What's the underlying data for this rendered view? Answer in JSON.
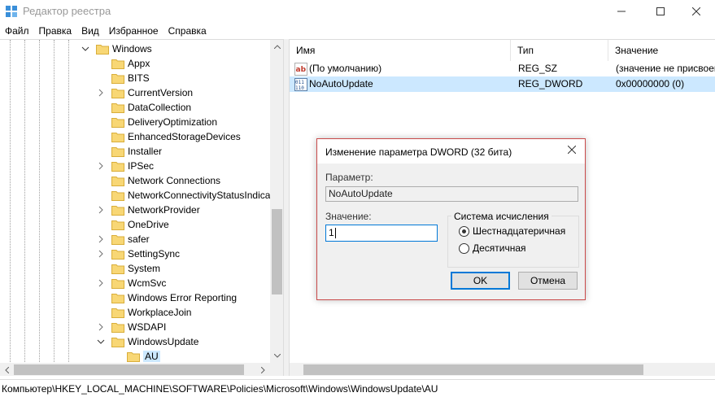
{
  "window": {
    "title": "Редактор реестра",
    "accent": "#0078d7"
  },
  "menu": [
    "Файл",
    "Правка",
    "Вид",
    "Избранное",
    "Справка"
  ],
  "tree": {
    "parent": "Windows",
    "children": [
      {
        "label": "Appx",
        "expandable": false
      },
      {
        "label": "BITS",
        "expandable": false
      },
      {
        "label": "CurrentVersion",
        "expandable": true
      },
      {
        "label": "DataCollection",
        "expandable": false
      },
      {
        "label": "DeliveryOptimization",
        "expandable": false
      },
      {
        "label": "EnhancedStorageDevices",
        "expandable": false
      },
      {
        "label": "Installer",
        "expandable": false
      },
      {
        "label": "IPSec",
        "expandable": true
      },
      {
        "label": "Network Connections",
        "expandable": false
      },
      {
        "label": "NetworkConnectivityStatusIndica",
        "expandable": false
      },
      {
        "label": "NetworkProvider",
        "expandable": true
      },
      {
        "label": "OneDrive",
        "expandable": false
      },
      {
        "label": "safer",
        "expandable": true
      },
      {
        "label": "SettingSync",
        "expandable": true
      },
      {
        "label": "System",
        "expandable": false
      },
      {
        "label": "WcmSvc",
        "expandable": true
      },
      {
        "label": "Windows Error Reporting",
        "expandable": false
      },
      {
        "label": "WorkplaceJoin",
        "expandable": false
      },
      {
        "label": "WSDAPI",
        "expandable": true
      },
      {
        "label": "WindowsUpdate",
        "expandable": "open"
      }
    ],
    "selected_child": "AU"
  },
  "list": {
    "columns": [
      "Имя",
      "Тип",
      "Значение"
    ],
    "rows": [
      {
        "icon": "string-value-icon",
        "name": "(По умолчанию)",
        "type": "REG_SZ",
        "value": "(значение не присвоено)"
      },
      {
        "icon": "dword-value-icon",
        "name": "NoAutoUpdate",
        "type": "REG_DWORD",
        "value": "0x00000000 (0)"
      }
    ]
  },
  "statusbar": {
    "path": "Компьютер\\HKEY_LOCAL_MACHINE\\SOFTWARE\\Policies\\Microsoft\\Windows\\WindowsUpdate\\AU"
  },
  "dialog": {
    "title": "Изменение параметра DWORD (32 бита)",
    "param_label": "Параметр:",
    "param_value": "NoAutoUpdate",
    "value_label": "Значение:",
    "value_input": "1",
    "base_caption": "Система исчисления",
    "base_options": [
      {
        "label": "Шестнадцатеричная",
        "checked": true
      },
      {
        "label": "Десятичная",
        "checked": false
      }
    ],
    "ok_label": "OK",
    "cancel_label": "Отмена"
  }
}
